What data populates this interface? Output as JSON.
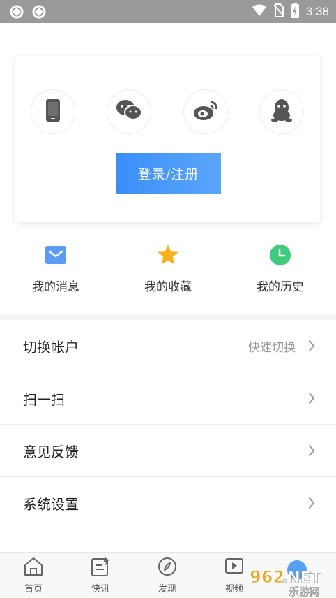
{
  "status_bar": {
    "time": "3:38",
    "left_icons": [
      "sync-icon",
      "sync-icon"
    ],
    "right_icons": [
      "wifi-icon",
      "no-sim-icon",
      "battery-charging-icon"
    ]
  },
  "login": {
    "social_icons": [
      "phone-icon",
      "wechat-icon",
      "weibo-icon",
      "qq-icon"
    ],
    "button_label": "登录/注册"
  },
  "quick_actions": [
    {
      "label": "我的消息",
      "icon": "message-icon",
      "color": "#5b9cf2"
    },
    {
      "label": "我的收藏",
      "icon": "star-icon",
      "color": "#f7b21b"
    },
    {
      "label": "我的历史",
      "icon": "clock-icon",
      "color": "#3fcb7c"
    }
  ],
  "menu": [
    {
      "label": "切换帐户",
      "hint": "快速切换"
    },
    {
      "label": "扫一扫",
      "hint": ""
    },
    {
      "label": "意见反馈",
      "hint": ""
    },
    {
      "label": "系统设置",
      "hint": ""
    }
  ],
  "bottom_nav": [
    {
      "label": "首页",
      "icon": "home-icon"
    },
    {
      "label": "快讯",
      "icon": "flash-news-icon"
    },
    {
      "label": "发现",
      "icon": "compass-icon"
    },
    {
      "label": "视频",
      "icon": "video-icon"
    }
  ],
  "watermark": {
    "brand": "962.NET",
    "sub": "乐游网"
  },
  "colors": {
    "accent": "#4a9af8",
    "status_bar": "#9a9a9a"
  }
}
